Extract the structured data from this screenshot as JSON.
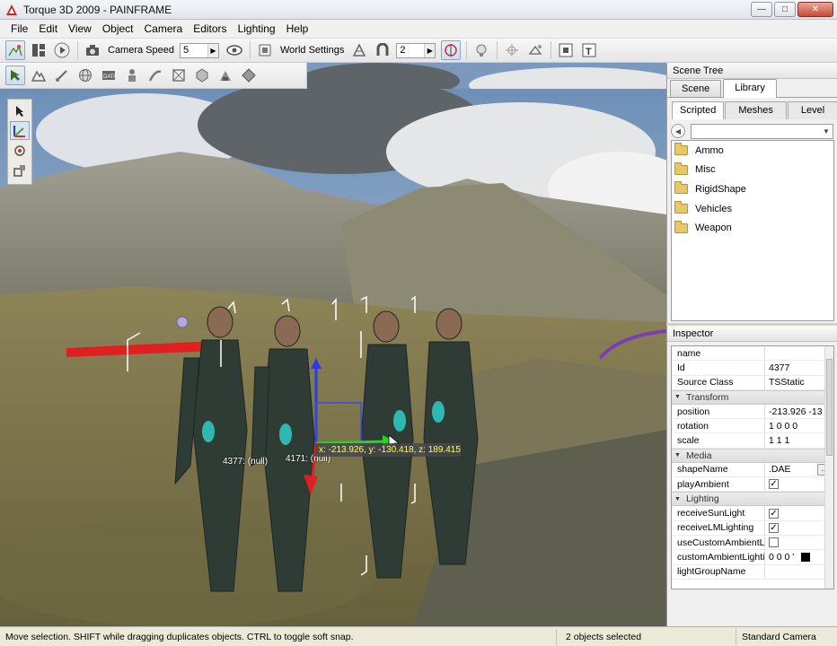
{
  "window": {
    "title": "Torque 3D 2009 - PAINFRAME",
    "minimize_icon": "minimize-icon",
    "maximize_icon": "maximize-icon",
    "close_icon": "close-icon"
  },
  "menu": [
    "File",
    "Edit",
    "View",
    "Object",
    "Camera",
    "Editors",
    "Lighting",
    "Help"
  ],
  "toolbar": {
    "camera_speed_label": "Camera Speed",
    "camera_speed_value": "5",
    "world_settings_label": "World Settings",
    "snap_value": "2"
  },
  "viewport": {
    "object_labels": [
      "4377: (null)",
      "4171: (null)"
    ],
    "coord_readout": "x: -213.926, y: -130.418, z: 189.415"
  },
  "scene_tree": {
    "title": "Scene Tree",
    "tabs": [
      "Scene",
      "Library"
    ],
    "active_tab": "Library",
    "subtabs": [
      "Scripted",
      "Meshes",
      "Level"
    ],
    "active_subtab": "Scripted",
    "items": [
      "Ammo",
      "Misc",
      "RigidShape",
      "Vehicles",
      "Weapon"
    ]
  },
  "inspector": {
    "title": "Inspector",
    "name_label": "name",
    "name_value": "",
    "id_label": "Id",
    "id_value": "4377",
    "class_label": "Source Class",
    "class_value": "TSStatic",
    "transform_group": "Transform",
    "position_label": "position",
    "position_value": "-213.926 -13",
    "rotation_label": "rotation",
    "rotation_value": "1 0 0 0",
    "scale_label": "scale",
    "scale_value": "1 1 1",
    "media_group": "Media",
    "shape_label": "shapeName",
    "shape_value": ".DAE",
    "play_ambient_label": "playAmbient",
    "lighting_group": "Lighting",
    "sun_light_label": "receiveSunLight",
    "lm_lighting_label": "receiveLMLighting",
    "use_custom_label": "useCustomAmbientLi...",
    "custom_ambient_label": "customAmbientLighti...",
    "custom_ambient_value": "0 0 0 '",
    "light_group_label": "lightGroupName"
  },
  "status": {
    "message": "Move selection.  SHIFT while dragging duplicates objects.  CTRL to toggle soft snap.",
    "selection": "2 objects selected",
    "camera": "Standard Camera"
  },
  "colors": {
    "accent_red": "#e02020",
    "gizmo_blue": "#2f39e0",
    "gizmo_green": "#26d61d",
    "folder": "#e7c76a"
  }
}
